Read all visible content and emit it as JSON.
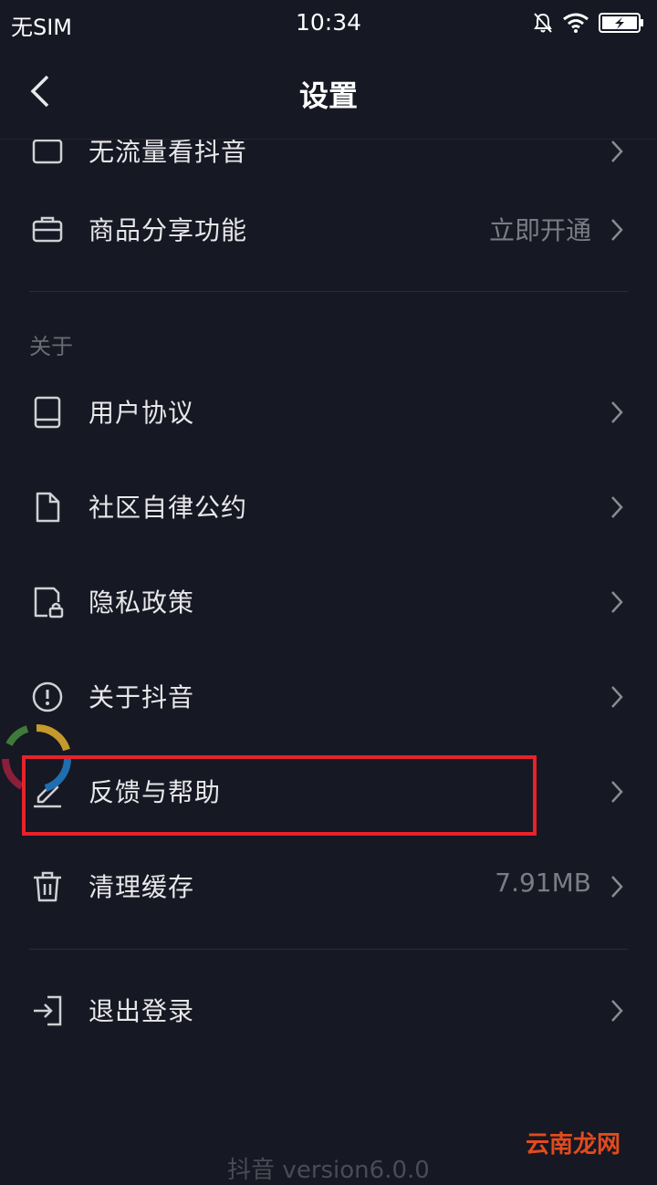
{
  "status": {
    "carrier": "无SIM",
    "time": "10:34"
  },
  "nav": {
    "title": "设置"
  },
  "rows": [
    {
      "label": "无流量看抖音",
      "value": "",
      "icon": "data-free-icon"
    },
    {
      "label": "商品分享功能",
      "value": "立即开通",
      "icon": "briefcase-icon"
    },
    {
      "label": "用户协议",
      "value": "",
      "icon": "book-icon"
    },
    {
      "label": "社区自律公约",
      "value": "",
      "icon": "document-icon"
    },
    {
      "label": "隐私政策",
      "value": "",
      "icon": "privacy-lock-icon"
    },
    {
      "label": "关于抖音",
      "value": "",
      "icon": "info-circle-icon"
    },
    {
      "label": "反馈与帮助",
      "value": "",
      "icon": "pencil-icon"
    },
    {
      "label": "清理缓存",
      "value": "7.91MB",
      "icon": "trash-icon"
    },
    {
      "label": "退出登录",
      "value": "",
      "icon": "logout-icon"
    }
  ],
  "section_about": "关于",
  "footer": {
    "version": "抖音 version6.0.0"
  },
  "watermark": "云南龙网",
  "colors": {
    "background": "#161823",
    "highlight": "#e4232a",
    "secondary_text": "#7c7d84"
  }
}
